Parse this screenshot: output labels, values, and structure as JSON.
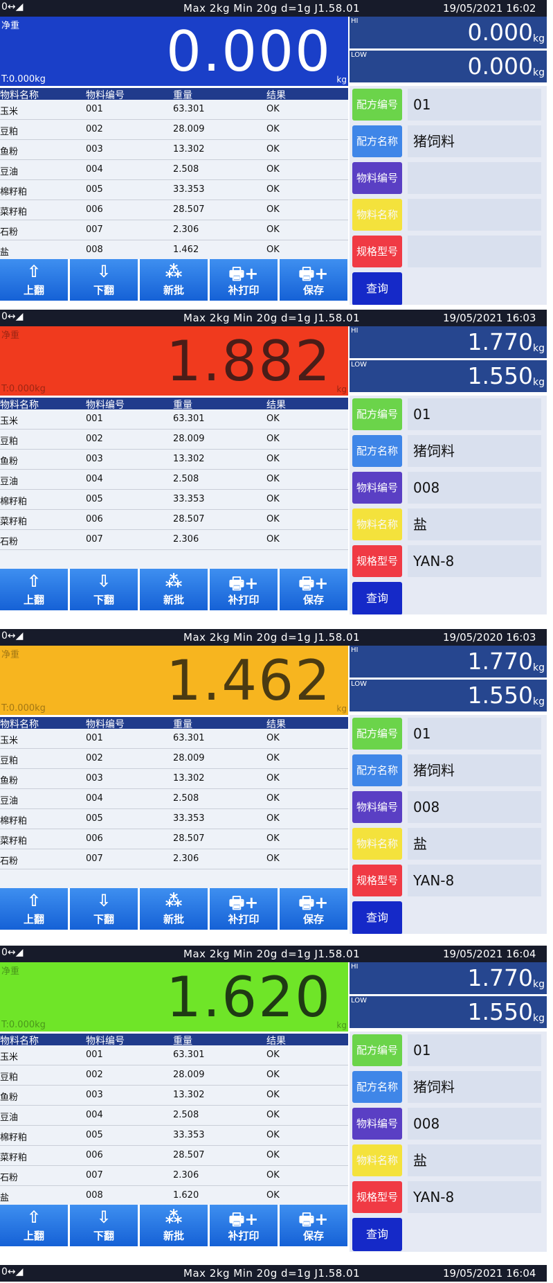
{
  "status_bar": {
    "icons": "0↔◢",
    "spec": "Max 2kg  Min 20g  d=1g    J1.58.01"
  },
  "labels": {
    "net_weight": "净重",
    "tare_zero": "T:0.000kg",
    "unit_kg": "kg",
    "kg": "kg",
    "hi": "HI",
    "low": "LOW"
  },
  "table_headers": [
    "物料名称",
    "物料编号",
    "重量",
    "结果"
  ],
  "buttons": {
    "page_up": "上翻",
    "page_down": "下翻",
    "new_batch": "新批",
    "reprint": "补打印",
    "save": "保存",
    "query": "查询"
  },
  "side_labels": [
    "配方编号",
    "配方名称",
    "物料编号",
    "物料名称",
    "规格型号"
  ],
  "screens": [
    {
      "datetime": "19/05/2021  16:02",
      "weight": "0.000",
      "display_color": "#1a3fc8",
      "display_text_color": "#ffffff",
      "hi": "0.000",
      "low": "0.000",
      "rows": [
        [
          "玉米",
          "001",
          "63.301",
          "OK"
        ],
        [
          "豆粕",
          "002",
          "28.009",
          "OK"
        ],
        [
          "鱼粉",
          "003",
          "13.302",
          "OK"
        ],
        [
          "豆油",
          "004",
          "2.508",
          "OK"
        ],
        [
          "棉籽粕",
          "005",
          "33.353",
          "OK"
        ],
        [
          "菜籽粕",
          "006",
          "28.507",
          "OK"
        ],
        [
          "石粉",
          "007",
          "2.306",
          "OK"
        ],
        [
          "盐",
          "008",
          "1.462",
          "OK"
        ]
      ],
      "side_values": [
        "01",
        "猪饲料",
        "",
        "",
        ""
      ]
    },
    {
      "datetime": "19/05/2021  16:03",
      "weight": "1.882",
      "display_color": "#f03a1e",
      "display_text_color": "#4a1d18",
      "hi": "1.770",
      "low": "1.550",
      "rows": [
        [
          "玉米",
          "001",
          "63.301",
          "OK"
        ],
        [
          "豆粕",
          "002",
          "28.009",
          "OK"
        ],
        [
          "鱼粉",
          "003",
          "13.302",
          "OK"
        ],
        [
          "豆油",
          "004",
          "2.508",
          "OK"
        ],
        [
          "棉籽粕",
          "005",
          "33.353",
          "OK"
        ],
        [
          "菜籽粕",
          "006",
          "28.507",
          "OK"
        ],
        [
          "石粉",
          "007",
          "2.306",
          "OK"
        ],
        [
          "",
          "",
          "",
          ""
        ]
      ],
      "side_values": [
        "01",
        "猪饲料",
        "008",
        "盐",
        "YAN-8"
      ]
    },
    {
      "datetime": "19/05/2020  16:03",
      "weight": "1.462",
      "display_color": "#f7b51f",
      "display_text_color": "#4a3a12",
      "hi": "1.770",
      "low": "1.550",
      "rows": [
        [
          "玉米",
          "001",
          "63.301",
          "OK"
        ],
        [
          "豆粕",
          "002",
          "28.009",
          "OK"
        ],
        [
          "鱼粉",
          "003",
          "13.302",
          "OK"
        ],
        [
          "豆油",
          "004",
          "2.508",
          "OK"
        ],
        [
          "棉籽粕",
          "005",
          "33.353",
          "OK"
        ],
        [
          "菜籽粕",
          "006",
          "28.507",
          "OK"
        ],
        [
          "石粉",
          "007",
          "2.306",
          "OK"
        ],
        [
          "",
          "",
          "",
          ""
        ]
      ],
      "side_values": [
        "01",
        "猪饲料",
        "008",
        "盐",
        "YAN-8"
      ]
    },
    {
      "datetime": "19/05/2021  16:04",
      "weight": "1.620",
      "display_color": "#6fe528",
      "display_text_color": "#1f3a14",
      "hi": "1.770",
      "low": "1.550",
      "rows": [
        [
          "玉米",
          "001",
          "63.301",
          "OK"
        ],
        [
          "豆粕",
          "002",
          "28.009",
          "OK"
        ],
        [
          "鱼粉",
          "003",
          "13.302",
          "OK"
        ],
        [
          "豆油",
          "004",
          "2.508",
          "OK"
        ],
        [
          "棉籽粕",
          "005",
          "33.353",
          "OK"
        ],
        [
          "菜籽粕",
          "006",
          "28.507",
          "OK"
        ],
        [
          "石粉",
          "007",
          "2.306",
          "OK"
        ],
        [
          "盐",
          "008",
          "1.620",
          "OK"
        ]
      ],
      "side_values": [
        "01",
        "猪饲料",
        "008",
        "盐",
        "YAN-8"
      ]
    }
  ],
  "footer_status": {
    "icons": "0↔◢",
    "spec": "Max 2kg  Min 20g  d=1g    J1.58.01",
    "datetime": "19/05/2021  16:04"
  },
  "colors": {
    "side_buttons": [
      "#6bd44a",
      "#3f86e8",
      "#5a3fc4",
      "#f4e23c",
      "#f03a44"
    ],
    "query": "#1529c8"
  }
}
